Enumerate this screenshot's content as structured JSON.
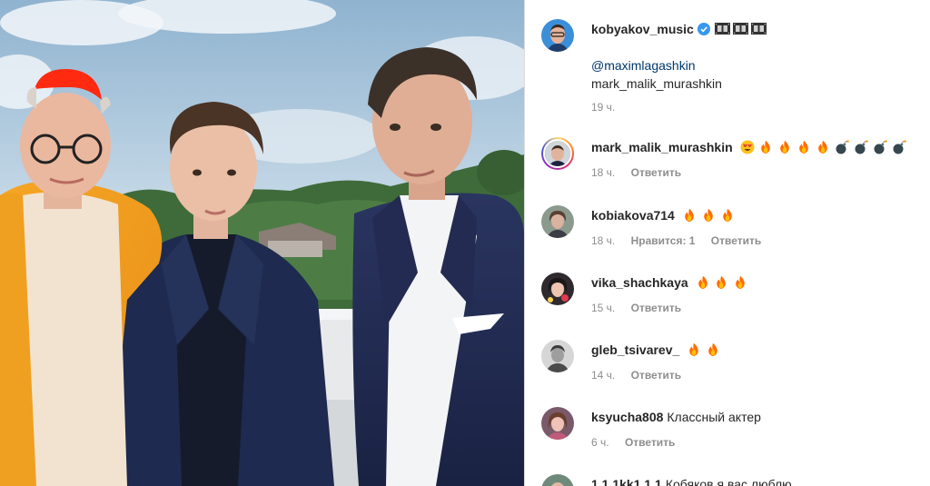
{
  "post": {
    "author": "kobyakov_music",
    "caption_glyphs": [
      "film-frame",
      "film-frame",
      "film-frame"
    ],
    "mention": "@maximlagashkin",
    "caption_second_line": "mark_malik_murashkin",
    "time": "19 ч."
  },
  "comments": [
    {
      "username": "mark_malik_murashkin",
      "text": "",
      "emojis": [
        "heart-eyes",
        "fire",
        "fire",
        "fire",
        "fire",
        "bomb",
        "bomb",
        "bomb",
        "bomb"
      ],
      "time": "18 ч.",
      "likes": "",
      "reply": "Ответить"
    },
    {
      "username": "kobiakova714",
      "text": "",
      "emojis": [
        "fire",
        "fire",
        "fire"
      ],
      "time": "18 ч.",
      "likes": "Нравится: 1",
      "reply": "Ответить"
    },
    {
      "username": "vika_shachkaya",
      "text": "",
      "emojis": [
        "fire",
        "fire",
        "fire"
      ],
      "time": "15 ч.",
      "likes": "",
      "reply": "Ответить"
    },
    {
      "username": "gleb_tsivarev_",
      "text": "",
      "emojis": [
        "fire",
        "fire"
      ],
      "time": "14 ч.",
      "likes": "",
      "reply": "Ответить"
    },
    {
      "username": "ksyucha808",
      "text": "Классный актер",
      "emojis": [],
      "time": "6 ч.",
      "likes": "",
      "reply": "Ответить"
    },
    {
      "username": "1.1.1kk1.1.1",
      "text": "Кобяков я вас люблю",
      "emojis": [],
      "time": "",
      "likes": "",
      "reply": ""
    }
  ],
  "colors": {
    "verified_badge": "#3897f0",
    "mention_link": "#00376b",
    "meta_gray": "#8e8e8e",
    "divider": "#dbdbdb"
  }
}
